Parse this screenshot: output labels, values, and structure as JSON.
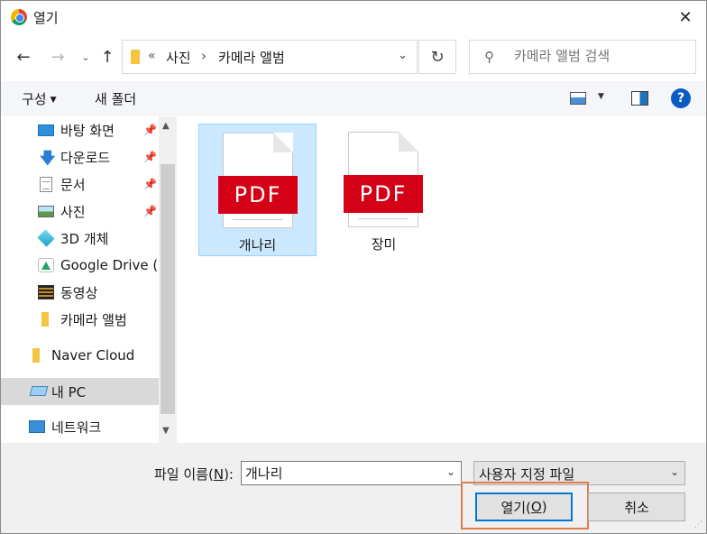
{
  "window": {
    "title": "열기",
    "close_glyph": "✕"
  },
  "nav": {
    "back_glyph": "←",
    "forward_glyph": "→",
    "recent_glyph": "⌄",
    "up_glyph": "↑"
  },
  "address": {
    "chevrons": "«",
    "crumbs": [
      "사진",
      "카메라 앨범"
    ],
    "separator": "›",
    "dropdown_glyph": "⌄",
    "refresh_glyph": "↻"
  },
  "search": {
    "placeholder": "카메라 앨범 검색",
    "value": ""
  },
  "toolbar": {
    "organize_label": "구성",
    "organize_caret": "▼",
    "new_folder_label": "새 폴더",
    "view_caret": "▼",
    "help_label": "?"
  },
  "sidebar": {
    "items": [
      {
        "label": "바탕 화면",
        "icon": "desktop-icon",
        "pinned": true
      },
      {
        "label": "다운로드",
        "icon": "download-icon",
        "pinned": true
      },
      {
        "label": "문서",
        "icon": "document-icon",
        "pinned": true
      },
      {
        "label": "사진",
        "icon": "pictures-icon",
        "pinned": true
      },
      {
        "label": "3D 개체",
        "icon": "3d-objects-icon",
        "pinned": false
      },
      {
        "label": "Google Drive (X",
        "icon": "google-drive-icon",
        "pinned": false
      },
      {
        "label": "동영상",
        "icon": "video-icon",
        "pinned": false
      },
      {
        "label": "카메라 앨범",
        "icon": "folder-icon",
        "pinned": false
      },
      {
        "label": "Naver Cloud",
        "icon": "folder-icon",
        "pinned": false
      },
      {
        "label": "내 PC",
        "icon": "this-pc-icon",
        "pinned": false,
        "selected": true
      },
      {
        "label": "네트워크",
        "icon": "network-icon",
        "pinned": false
      }
    ],
    "pin_glyph": "📌",
    "scroll_up_glyph": "▲",
    "scroll_down_glyph": "▼"
  },
  "files": [
    {
      "name": "개나리",
      "type_badge": "PDF",
      "selected": true
    },
    {
      "name": "장미",
      "type_badge": "PDF",
      "selected": false
    }
  ],
  "footer": {
    "filename_label": "파일 이름(N):",
    "filename_label_pre": "파일 이름(",
    "filename_label_key": "N",
    "filename_label_post": "):",
    "filename_value": "개나리",
    "combo_caret": "⌄",
    "filetype_value": "사용자 지정 파일",
    "open_label_pre": "열기(",
    "open_label_key": "O",
    "open_label_post": ")",
    "cancel_label": "취소",
    "grip_glyph": "⋰"
  },
  "colors": {
    "selection": "#cce8ff",
    "pdf_red": "#d40016",
    "default_button_border": "#0078d7",
    "highlight": "#e07a4f",
    "help_blue": "#0a5bc4"
  }
}
